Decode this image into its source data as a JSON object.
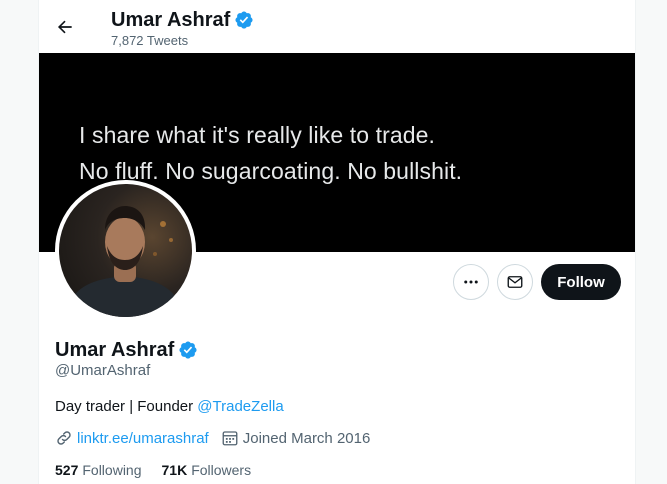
{
  "header": {
    "name": "Umar Ashraf",
    "tweet_count": "7,872 Tweets"
  },
  "banner": {
    "line1": "I share what it's really like to trade.",
    "line2": "No fluff. No sugarcoating. No bullshit."
  },
  "actions": {
    "follow_label": "Follow"
  },
  "profile": {
    "name": "Umar Ashraf",
    "handle": "@UmarAshraf",
    "bio_text": "Day trader | Founder ",
    "bio_link": "@TradeZella",
    "website": "linktr.ee/umarashraf",
    "joined": "Joined March 2016",
    "following_count": "527",
    "following_label": "Following",
    "followers_count": "71K",
    "followers_label": "Followers"
  },
  "colors": {
    "accent": "#1d9bf0",
    "text": "#0f1419",
    "muted": "#536471",
    "follow_button": "#0f1419"
  },
  "icons": [
    "back-arrow-icon",
    "verified-badge-icon",
    "more-icon",
    "message-icon",
    "link-icon",
    "calendar-icon"
  ]
}
